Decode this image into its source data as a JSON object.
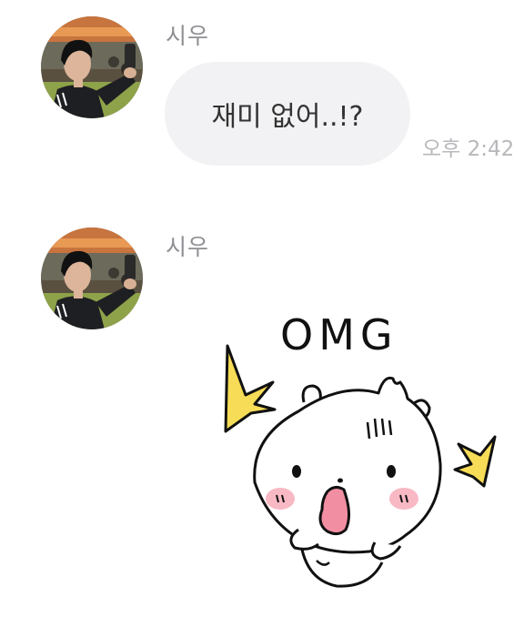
{
  "messages": [
    {
      "sender": "시우",
      "text": "재미 없어..!?",
      "time": "오후 2:42"
    },
    {
      "sender": "시우",
      "sticker": {
        "icon": "omg-hamster-sticker",
        "caption": "OMG"
      }
    }
  ],
  "colors": {
    "bubble_bg": "#f2f2f4",
    "sender_text": "#8e8e93",
    "time_text": "#b8b8bc",
    "sticker_accent": "#f7dc57",
    "sticker_blush": "#f8b8c4"
  }
}
